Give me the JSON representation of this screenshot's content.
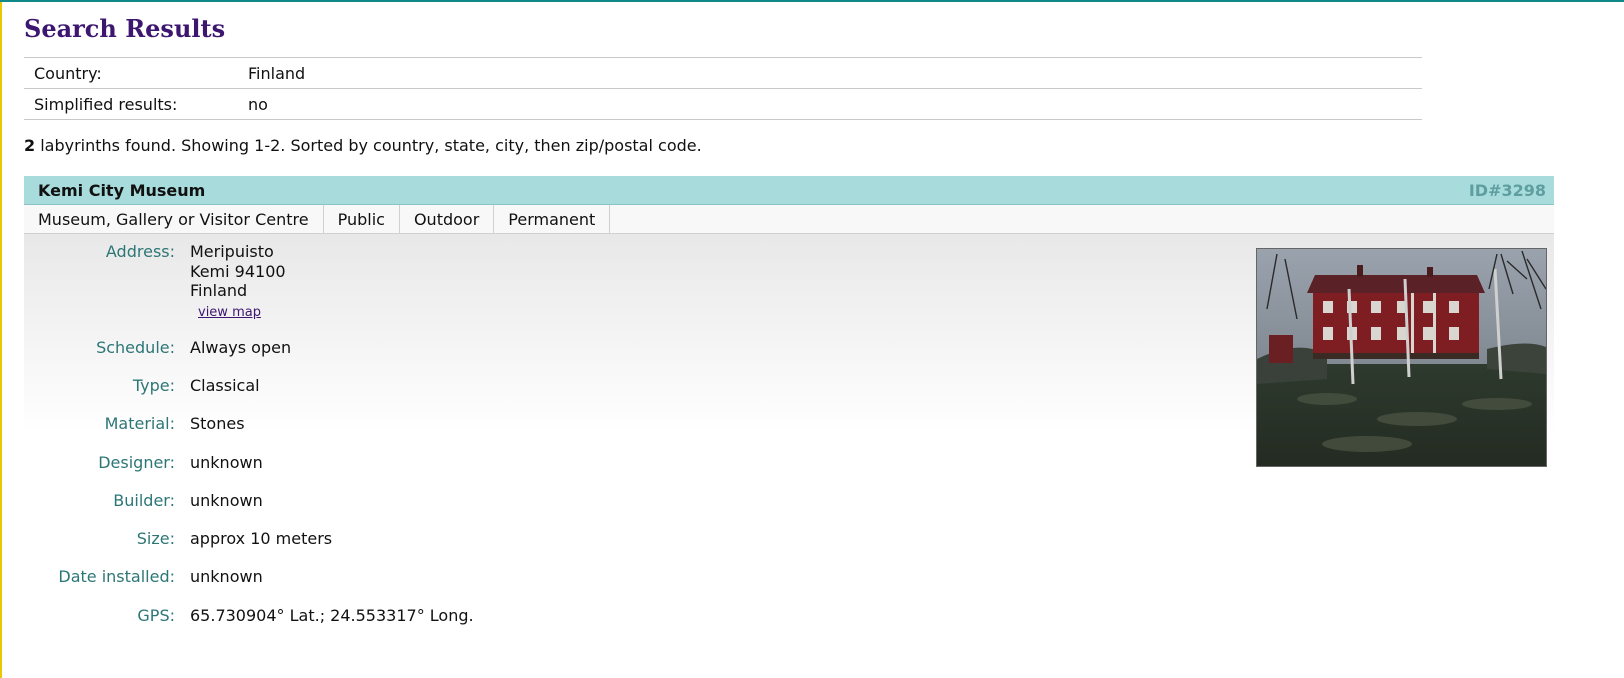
{
  "page": {
    "title": "Search Results"
  },
  "criteria": [
    {
      "label": "Country:",
      "value": "Finland"
    },
    {
      "label": "Simplified results:",
      "value": "no"
    }
  ],
  "summary": {
    "count": "2",
    "text": " labyrinths found. Showing 1-2. Sorted by country, state, city, then zip/postal code."
  },
  "result": {
    "name": "Kemi City Museum",
    "id": "ID#3298",
    "tags": [
      "Museum, Gallery or Visitor Centre",
      "Public",
      "Outdoor",
      "Permanent"
    ],
    "address_label": "Address:",
    "address_lines": [
      "Meripuisto",
      "Kemi 94100",
      "Finland"
    ],
    "view_map": "view map",
    "fields": [
      {
        "label": "Schedule:",
        "value": "Always open"
      },
      {
        "label": "Type:",
        "value": "Classical"
      },
      {
        "label": "Material:",
        "value": "Stones"
      },
      {
        "label": "Designer:",
        "value": "unknown"
      },
      {
        "label": "Builder:",
        "value": "unknown"
      },
      {
        "label": "Size:",
        "value": "approx 10 meters"
      },
      {
        "label": "Date installed:",
        "value": "unknown"
      },
      {
        "label": "GPS:",
        "value": "65.730904° Lat.; 24.553317° Long."
      }
    ]
  },
  "colors": {
    "accent": "#108888",
    "title": "#3d1670",
    "header_bg": "#a8dcdc",
    "label": "#2d7676"
  }
}
